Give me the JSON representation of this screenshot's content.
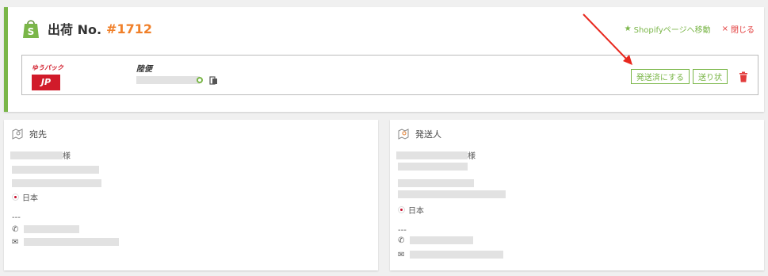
{
  "shipment": {
    "title": "出荷 No.",
    "order_no": "#1712",
    "shopify_link": "Shopifyページへ移動",
    "close_label": "閉じる",
    "carrier_logo_text": "ゆうパック",
    "carrier_badge": "JP",
    "method": "陸便",
    "mark_shipped_button": "発送済にする",
    "label_button": "送り状"
  },
  "recipient": {
    "heading": "宛先",
    "name_suffix": "様",
    "country": "日本",
    "separator": "---"
  },
  "sender": {
    "heading": "発送人",
    "name_suffix": "様",
    "country": "日本",
    "separator": "---"
  },
  "colors": {
    "accent": "#7ab648",
    "order_no": "#f0802a",
    "danger": "#e23b3b",
    "japan_post_red": "#d11b2a"
  }
}
